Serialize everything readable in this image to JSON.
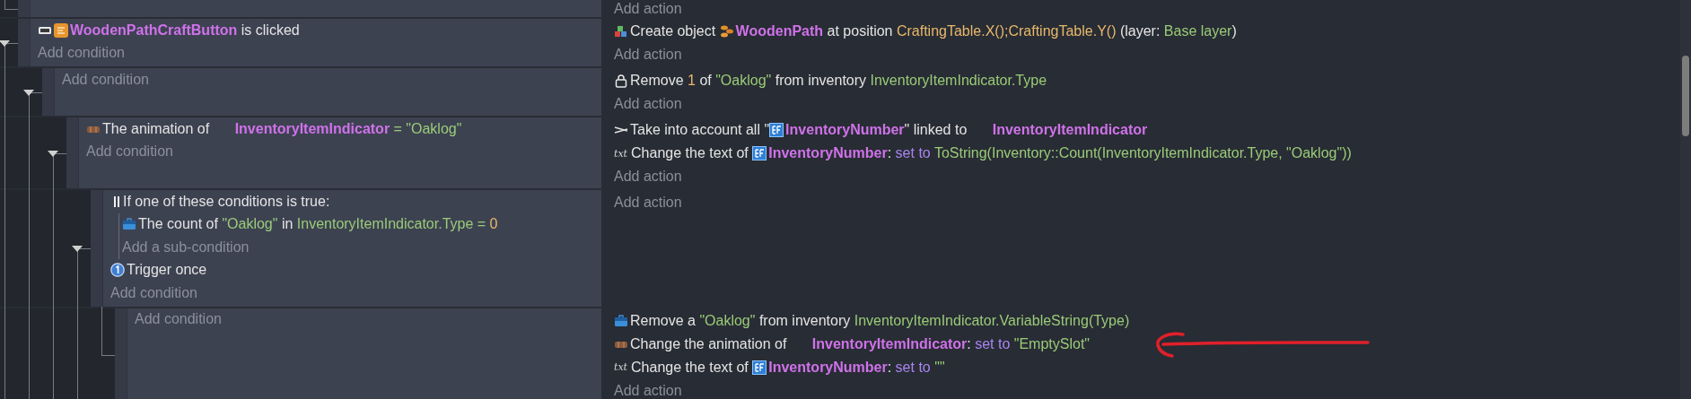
{
  "events": [
    {
      "add_action": "Add action"
    },
    {
      "conditions": [
        {
          "kind": "button_clicked",
          "parts": [
            {
              "kind": "button_object",
              "text": "WoodenPathCraftButton"
            },
            {
              "kind": "plain",
              "text": " is clicked"
            }
          ]
        }
      ],
      "add_condition": "Add condition",
      "actions": [
        {
          "kind": "create_object",
          "parts": [
            {
              "kind": "plain",
              "text": "Create object "
            },
            {
              "kind": "sprite_object",
              "text": "WoodenPath"
            },
            {
              "kind": "plain",
              "text": " at position "
            },
            {
              "kind": "expression",
              "text": "CraftingTable.X();CraftingTable.Y()"
            },
            {
              "kind": "plain",
              "text": " (layer: "
            },
            {
              "kind": "string",
              "text": "Base layer"
            },
            {
              "kind": "plain",
              "text": ")"
            }
          ]
        }
      ],
      "add_action": "Add action",
      "children": [
        {
          "add_condition": "Add condition",
          "actions": [
            {
              "kind": "remove_item",
              "parts": [
                {
                  "kind": "plain",
                  "text": "Remove "
                },
                {
                  "kind": "expression",
                  "text": "1"
                },
                {
                  "kind": "plain",
                  "text": " of "
                },
                {
                  "kind": "string",
                  "text": "\"Oaklog\""
                },
                {
                  "kind": "plain",
                  "text": " from inventory "
                },
                {
                  "kind": "string",
                  "text": "InventoryItemIndicator.Type"
                }
              ]
            }
          ],
          "add_action": "Add action",
          "children": [
            {
              "conditions": [
                {
                  "kind": "animation",
                  "parts": [
                    {
                      "kind": "plain",
                      "text": "The animation of "
                    },
                    {
                      "kind": "object",
                      "text": "InventoryItemIndicator"
                    },
                    {
                      "kind": "string",
                      "text": " = "
                    },
                    {
                      "kind": "string",
                      "text": "\"Oaklog\""
                    }
                  ]
                }
              ],
              "add_condition": "Add condition",
              "actions": [
                {
                  "kind": "link",
                  "parts": [
                    {
                      "kind": "plain",
                      "text": "Take into account all \""
                    },
                    {
                      "kind": "text_object",
                      "text": "InventoryNumber"
                    },
                    {
                      "kind": "plain",
                      "text": "\" linked to "
                    },
                    {
                      "kind": "object",
                      "text": "InventoryItemIndicator"
                    }
                  ]
                },
                {
                  "kind": "change_text",
                  "label": "txt",
                  "parts": [
                    {
                      "kind": "plain",
                      "text": "Change the text of "
                    },
                    {
                      "kind": "text_object",
                      "text": "InventoryNumber"
                    },
                    {
                      "kind": "plain",
                      "text": ": "
                    },
                    {
                      "kind": "keyword",
                      "text": "set to"
                    },
                    {
                      "kind": "string",
                      "text": " ToString(Inventory::Count(InventoryItemIndicator.Type, \"Oaklog\"))"
                    }
                  ]
                }
              ],
              "add_action": "Add action",
              "children": [
                {
                  "conditions": [
                    {
                      "kind": "or_group",
                      "title": "If one of these conditions is true:",
                      "conditions": [
                        {
                          "kind": "inventory_count",
                          "parts": [
                            {
                              "kind": "plain",
                              "text": "The count of "
                            },
                            {
                              "kind": "string",
                              "text": "\"Oaklog\""
                            },
                            {
                              "kind": "plain",
                              "text": " in "
                            },
                            {
                              "kind": "string",
                              "text": "InventoryItemIndicator.Type"
                            },
                            {
                              "kind": "string",
                              "text": " = "
                            },
                            {
                              "kind": "expression",
                              "text": "0"
                            }
                          ]
                        }
                      ],
                      "add_sub_condition": "Add a sub-condition"
                    },
                    {
                      "kind": "trigger_once",
                      "parts": [
                        {
                          "kind": "plain",
                          "text": "Trigger once"
                        }
                      ]
                    }
                  ],
                  "add_condition": "Add condition",
                  "add_action": "Add action",
                  "children": [
                    {
                      "add_condition": "Add condition",
                      "actions": [
                        {
                          "kind": "remove_inventory",
                          "parts": [
                            {
                              "kind": "plain",
                              "text": "Remove a "
                            },
                            {
                              "kind": "string",
                              "text": "\"Oaklog\""
                            },
                            {
                              "kind": "plain",
                              "text": " from inventory "
                            },
                            {
                              "kind": "string",
                              "text": "InventoryItemIndicator.VariableString(Type)"
                            }
                          ]
                        },
                        {
                          "kind": "change_animation",
                          "parts": [
                            {
                              "kind": "plain",
                              "text": "Change the animation of "
                            },
                            {
                              "kind": "object",
                              "text": "InventoryItemIndicator"
                            },
                            {
                              "kind": "plain",
                              "text": ": "
                            },
                            {
                              "kind": "keyword",
                              "text": "set to"
                            },
                            {
                              "kind": "string",
                              "text": " \"EmptySlot\""
                            }
                          ]
                        },
                        {
                          "kind": "change_text",
                          "label": "txt",
                          "parts": [
                            {
                              "kind": "plain",
                              "text": "Change the text of "
                            },
                            {
                              "kind": "text_object",
                              "text": "InventoryNumber"
                            },
                            {
                              "kind": "plain",
                              "text": ": "
                            },
                            {
                              "kind": "keyword",
                              "text": "set to"
                            },
                            {
                              "kind": "string",
                              "text": " \"\""
                            }
                          ]
                        }
                      ],
                      "add_action": "Add action"
                    }
                  ]
                }
              ]
            }
          ]
        }
      ]
    }
  ],
  "annotation": {
    "kind": "arrow"
  }
}
